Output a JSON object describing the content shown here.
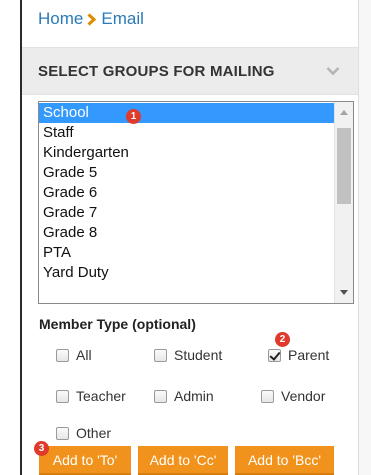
{
  "breadcrumb": {
    "home": "Home",
    "current": "Email"
  },
  "section": {
    "title": "SELECT GROUPS FOR MAILING"
  },
  "groups": {
    "items": [
      "School",
      "Staff",
      "Kindergarten",
      "Grade 5",
      "Grade 6",
      "Grade 7",
      "Grade 8",
      "PTA",
      "Yard Duty"
    ],
    "selected": "School"
  },
  "member_type": {
    "label": "Member Type (optional)",
    "options": [
      {
        "label": "All",
        "checked": false
      },
      {
        "label": "Student",
        "checked": false
      },
      {
        "label": "Parent",
        "checked": true
      },
      {
        "label": "Teacher",
        "checked": false
      },
      {
        "label": "Admin",
        "checked": false
      },
      {
        "label": "Vendor",
        "checked": false
      },
      {
        "label": "Other",
        "checked": false
      }
    ]
  },
  "buttons": {
    "to": "Add to 'To'",
    "cc": "Add to 'Cc'",
    "bcc": "Add to 'Bcc'"
  },
  "annotations": {
    "one": "1",
    "two": "2",
    "three": "3"
  },
  "colors": {
    "link": "#2a7ab8",
    "accent": "#f0921b",
    "selection": "#3399ff",
    "badge": "#e03a2c"
  }
}
